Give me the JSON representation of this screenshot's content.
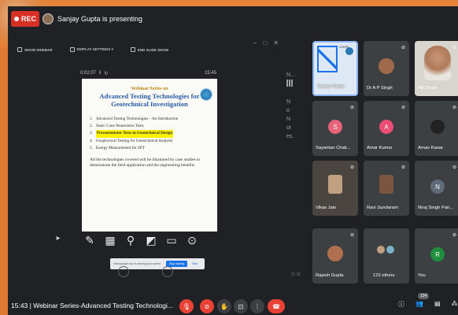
{
  "topbar": {
    "rec_label": "REC",
    "presenting": "Sanjay Gupta is presenting"
  },
  "slide_toolbar": {
    "show_sidebar": "SHOW SIDEBAR",
    "display_settings": "DISPLAY SETTINGS ▾",
    "end_slideshow": "END SLIDE SHOW"
  },
  "presenter_view": {
    "elapsed": "0:02:07",
    "clock": "15:45"
  },
  "slide": {
    "subtitle": "Webinar Series on",
    "title": "Advanced Testing Technologies for Geotechnical Investigation",
    "items": [
      {
        "num": "1.",
        "text": "Advanced Testing Technologies – An Introduction",
        "highlight": false
      },
      {
        "num": "2.",
        "text": "Static Cone Penetration Tests",
        "highlight": false
      },
      {
        "num": "3.",
        "text": "Pressuremeter Tests in Geotechnical Design",
        "highlight": true
      },
      {
        "num": "4.",
        "text": "Geophysical Testing for Geotechnical Analysis",
        "highlight": false
      },
      {
        "num": "5.",
        "text": "Energy Measurement for SPT",
        "highlight": false
      }
    ],
    "footer": "All the technologies covered will be illustrated by case studies to demonstrate the field application and the engineering benefits"
  },
  "notes_strip": {
    "top": "N...",
    "lines": [
      "N",
      "o",
      "N",
      "ot",
      "es."
    ]
  },
  "share_banner": {
    "message": "meet.google.com is sharing your screen.",
    "stop": "Stop sharing",
    "hide": "Hide"
  },
  "participants": [
    {
      "name": "Sanjay Gupta",
      "type": "active"
    },
    {
      "name": "Dr A P Singh",
      "type": "photo",
      "color": "#a06a4a"
    },
    {
      "name": "AB Singh",
      "type": "camera"
    },
    {
      "name": "Sayantan Chak...",
      "type": "initial",
      "initial": "S",
      "color": "#e8637a"
    },
    {
      "name": "Amar Kumar",
      "type": "initial",
      "initial": "A",
      "color": "#ec4d74"
    },
    {
      "name": "Arnav Kasar",
      "type": "photo",
      "color": "#222222"
    },
    {
      "name": "Vikas Jain",
      "type": "photo",
      "color": "#c0a080"
    },
    {
      "name": "Ravi Sundaram",
      "type": "photo",
      "color": "#7a5540"
    },
    {
      "name": "Niraj Singh Pari...",
      "type": "initial",
      "initial": "N",
      "color": "#5f6b78"
    },
    {
      "name": "Rajesh Gupta",
      "type": "photo",
      "color": "#b07050"
    },
    {
      "name": "122 others",
      "type": "others"
    },
    {
      "name": "You",
      "type": "initial",
      "initial": "R",
      "color": "#1e8e3e"
    }
  ],
  "bottombar": {
    "time_title": "15:43 | Webinar Series-Advanced Testing Technologi...",
    "participant_count": "134"
  }
}
